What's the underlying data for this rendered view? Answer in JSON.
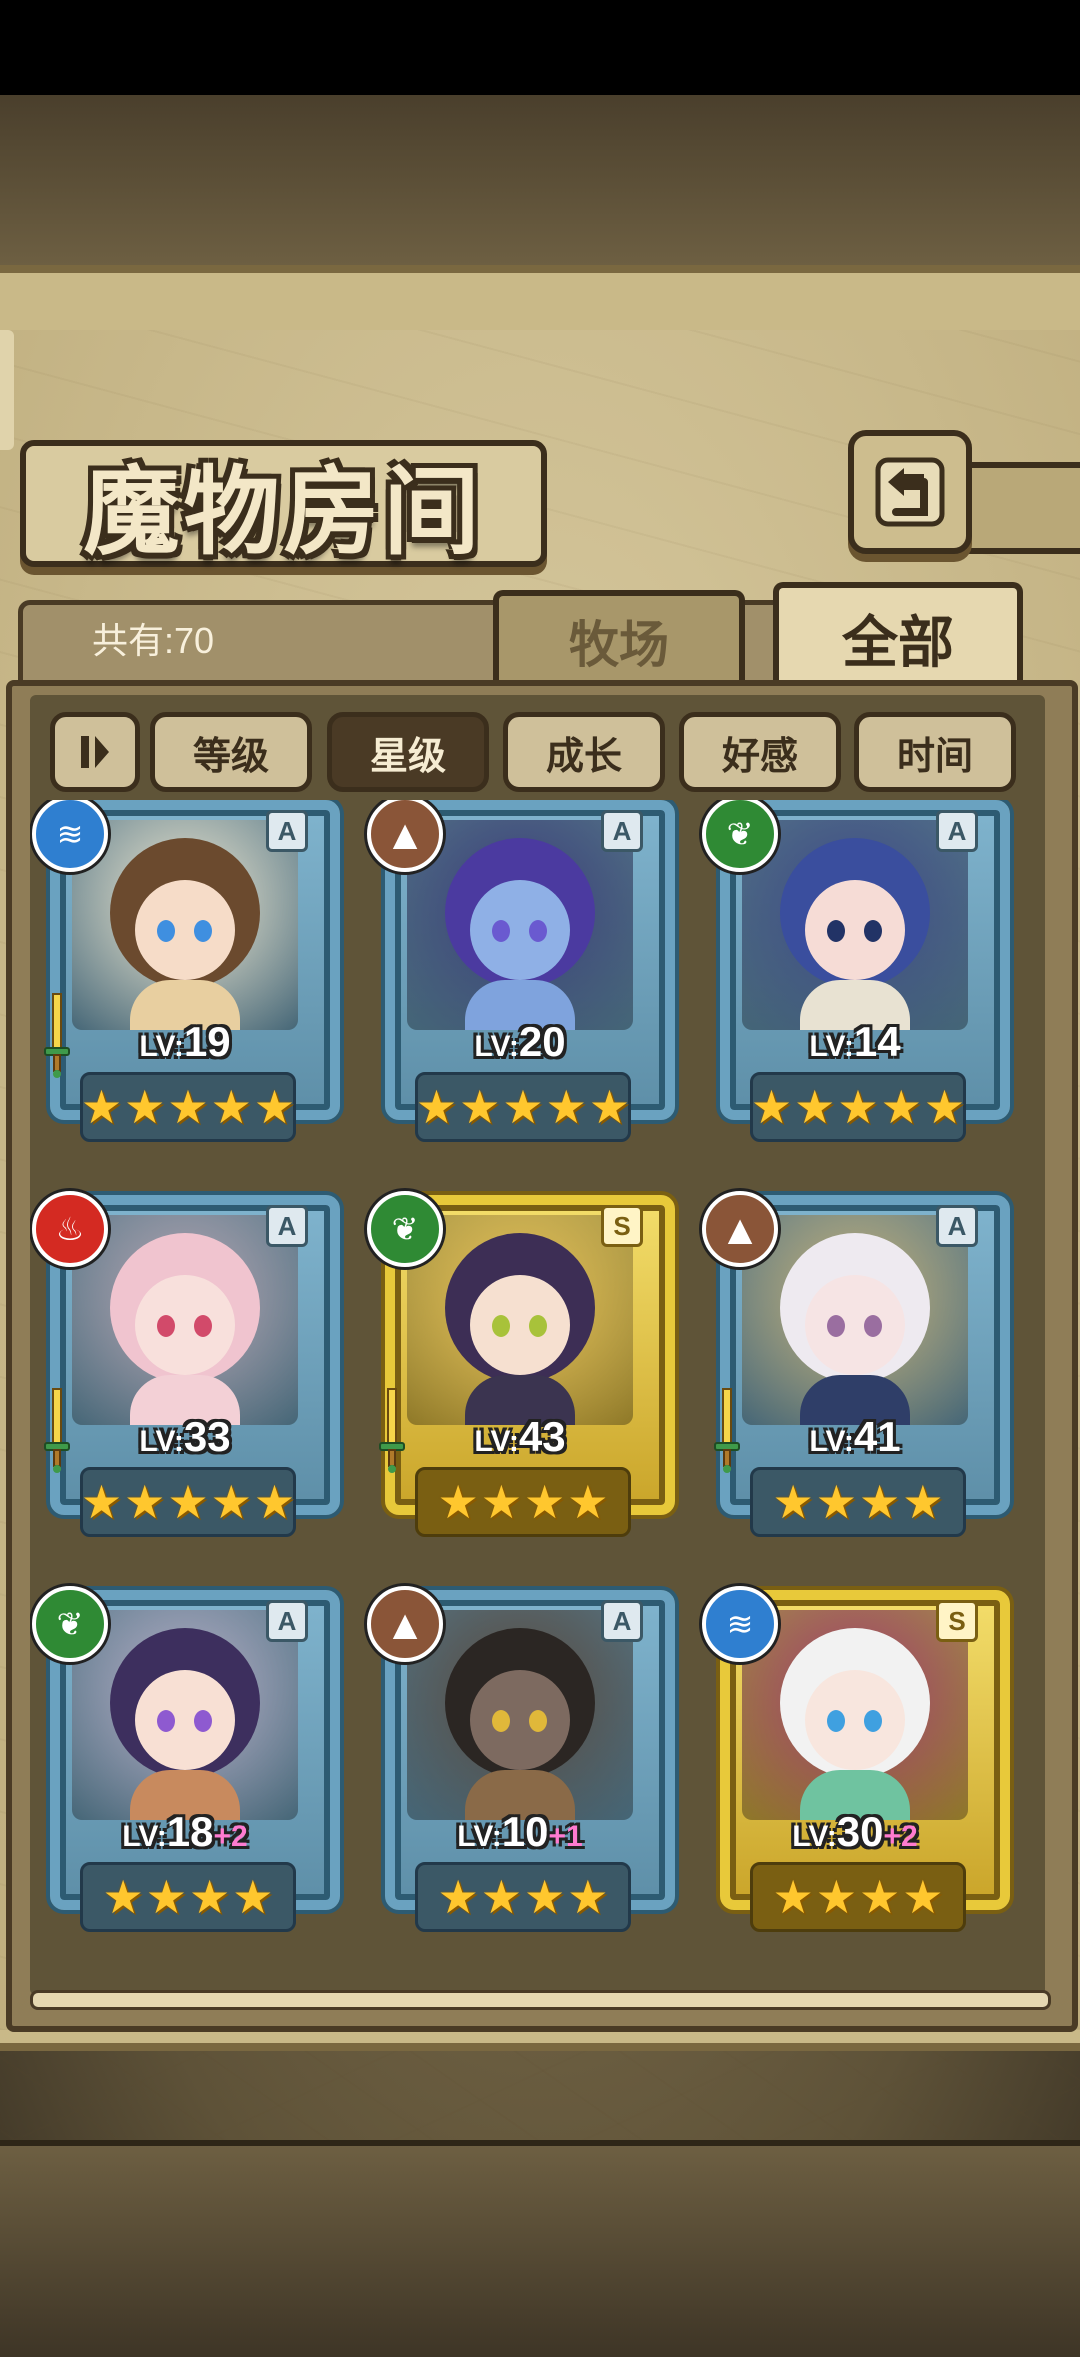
{
  "screen": {
    "title": "魔物房间",
    "count_label": "共有:70",
    "tabs": {
      "ranch": "牧场",
      "all": "全部"
    },
    "sort_buttons": [
      "等级",
      "星级",
      "成长",
      "好感",
      "时间"
    ],
    "active_sort": "星级",
    "back_icon": "back-arrow-icon",
    "sort_toggle_icon": "sort-order-icon"
  },
  "colors": {
    "water": "#2f7fd0",
    "earth": "#8a5538",
    "wood": "#2f8a34",
    "fire": "#d42a22",
    "frame_A": "#6aa2c0",
    "frame_S": "#e8c93a",
    "bonus": "#ff7bd0"
  },
  "monsters": [
    {
      "rank": "A",
      "element": "water",
      "level": "19",
      "bonus": "",
      "stars": 5,
      "has_sword": true,
      "hair": "#6b4a2e",
      "skin": "#f6dcc8",
      "eye": "#3f8fe0",
      "outfit": "#e8cfa0",
      "bg": "#f2ead2"
    },
    {
      "rank": "A",
      "element": "earth",
      "level": "20",
      "bonus": "",
      "stars": 5,
      "has_sword": false,
      "hair": "#4b3aa0",
      "skin": "#8fb0e6",
      "eye": "#6a5ad0",
      "outfit": "#7fa3dd",
      "bg": "#3c3f7a"
    },
    {
      "rank": "A",
      "element": "wood",
      "level": "14",
      "bonus": "",
      "stars": 5,
      "has_sword": false,
      "hair": "#3a4e9e",
      "skin": "#f6dcd6",
      "eye": "#223366",
      "outfit": "#e8e2d2",
      "bg": "#3f4a86"
    },
    {
      "rank": "A",
      "element": "fire",
      "level": "33",
      "bonus": "",
      "stars": 5,
      "has_sword": true,
      "hair": "#f0c4cf",
      "skin": "#f8e0dc",
      "eye": "#d24a6a",
      "outfit": "#f3d0d6",
      "bg": "#b9a8b4"
    },
    {
      "rank": "S",
      "element": "wood",
      "level": "43",
      "bonus": "",
      "stars": 4,
      "has_sword": true,
      "hair": "#3d2e55",
      "skin": "#f6e0d0",
      "eye": "#a8c23a",
      "outfit": "#3b3450",
      "bg": "#e9c45a"
    },
    {
      "rank": "A",
      "element": "earth",
      "level": "41",
      "bonus": "",
      "stars": 4,
      "has_sword": true,
      "hair": "#eeeaf0",
      "skin": "#f6e4e4",
      "eye": "#9a6ea0",
      "outfit": "#2f3e68",
      "bg": "#c9b47a"
    },
    {
      "rank": "A",
      "element": "wood",
      "level": "18",
      "bonus": "+2",
      "stars": 4,
      "has_sword": false,
      "hair": "#3d2f5e",
      "skin": "#f8e0d4",
      "eye": "#8e5ad0",
      "outfit": "#c88a5e",
      "bg": "#b9b0c8"
    },
    {
      "rank": "A",
      "element": "earth",
      "level": "10",
      "bonus": "+1",
      "stars": 4,
      "has_sword": false,
      "hair": "#2b2623",
      "skin": "#7d6a60",
      "eye": "#e0b83a",
      "outfit": "#8a6a48",
      "bg": "#5a4a3e"
    },
    {
      "rank": "S",
      "element": "water",
      "level": "30",
      "bonus": "+2",
      "stars": 4,
      "has_sword": false,
      "hair": "#f2f2f2",
      "skin": "#f8e6de",
      "eye": "#3fa0e0",
      "outfit": "#6fc3a0",
      "bg": "#a23c6e"
    }
  ]
}
